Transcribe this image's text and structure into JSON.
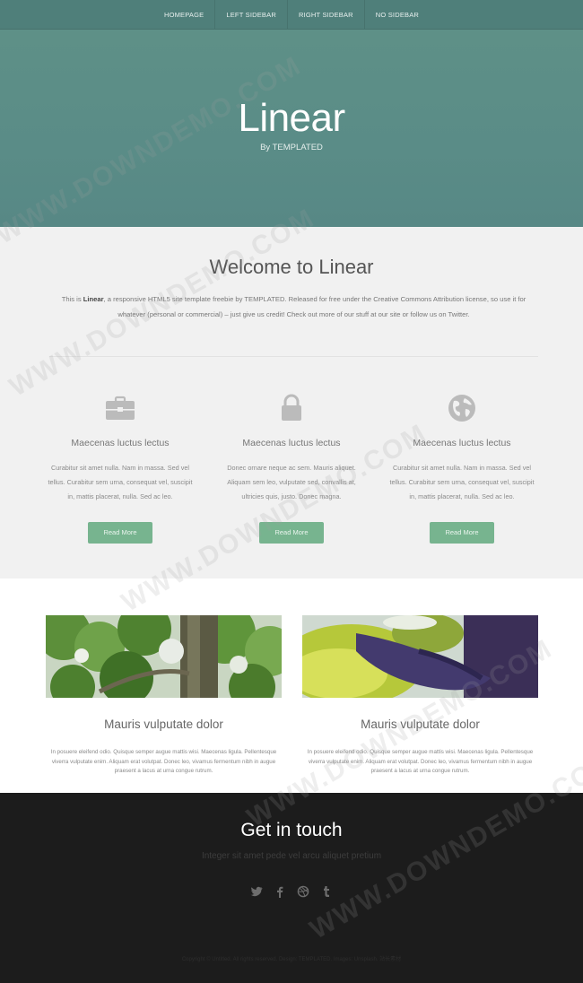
{
  "nav": {
    "items": [
      {
        "label": "HOMEPAGE"
      },
      {
        "label": "LEFT SIDEBAR"
      },
      {
        "label": "RIGHT SIDEBAR"
      },
      {
        "label": "NO SIDEBAR"
      }
    ]
  },
  "hero": {
    "title": "Linear",
    "subtitle": "By TEMPLATED"
  },
  "welcome": {
    "title": "Welcome to Linear",
    "text_prefix": "This is ",
    "text_bold": "Linear",
    "text_rest": ", a responsive HTML5 site template freebie by TEMPLATED. Released for free under the Creative Commons Attribution license, so use it for whatever (personal or commercial) – just give us credit! Check out more of our stuff at our site or follow us on Twitter."
  },
  "features": [
    {
      "icon": "briefcase-icon",
      "title": "Maecenas luctus lectus",
      "text": "Curabitur sit amet nulla. Nam in massa. Sed vel tellus. Curabitur sem urna, consequat vel, suscipit in, mattis placerat, nulla. Sed ac leo.",
      "button": "Read More"
    },
    {
      "icon": "lock-icon",
      "title": "Maecenas luctus lectus",
      "text": "Donec ornare neque ac sem. Mauris aliquet. Aliquam sem leo, vulputate sed, convallis at, ultricies quis, justo. Donec magna.",
      "button": "Read More"
    },
    {
      "icon": "globe-icon",
      "title": "Maecenas luctus lectus",
      "text": "Curabitur sit amet nulla. Nam in massa. Sed vel tellus. Curabitur sem urna, consequat vel, suscipit in, mattis placerat, nulla. Sed ac leo.",
      "button": "Read More"
    }
  ],
  "gallery": [
    {
      "title": "Mauris vulputate dolor",
      "text": "In posuere eleifend odio. Quisque semper augue mattis wisi. Maecenas ligula. Pellentesque viverra vulputate enim. Aliquam erat volutpat. Donec leo, vivamus fermentum nibh in augue praesent a lacus at urna congue rutrum."
    },
    {
      "title": "Mauris vulputate dolor",
      "text": "In posuere eleifend odio. Quisque semper augue mattis wisi. Maecenas ligula. Pellentesque viverra vulputate enim. Aliquam erat volutpat. Donec leo, vivamus fermentum nibh in augue praesent a lacus at urna congue rutrum."
    }
  ],
  "footer": {
    "title": "Get in touch",
    "subtitle": "Integer sit amet pede vel arcu aliquet pretium",
    "social": [
      "twitter-icon",
      "facebook-icon",
      "dribbble-icon",
      "tumblr-icon"
    ],
    "copyright": "Copyright © Untitled. All rights reserved. Design: TEMPLATED. Images: Unsplash. 站长素材",
    "copyright_highlight": "站长素材"
  },
  "watermark": "WWW.DOWNDEMO.COM",
  "colors": {
    "nav_bg": "#4f7f7a",
    "hero_bg": "#5a8c87",
    "button_bg": "#77b48f",
    "footer_bg": "#1c1c1c"
  }
}
